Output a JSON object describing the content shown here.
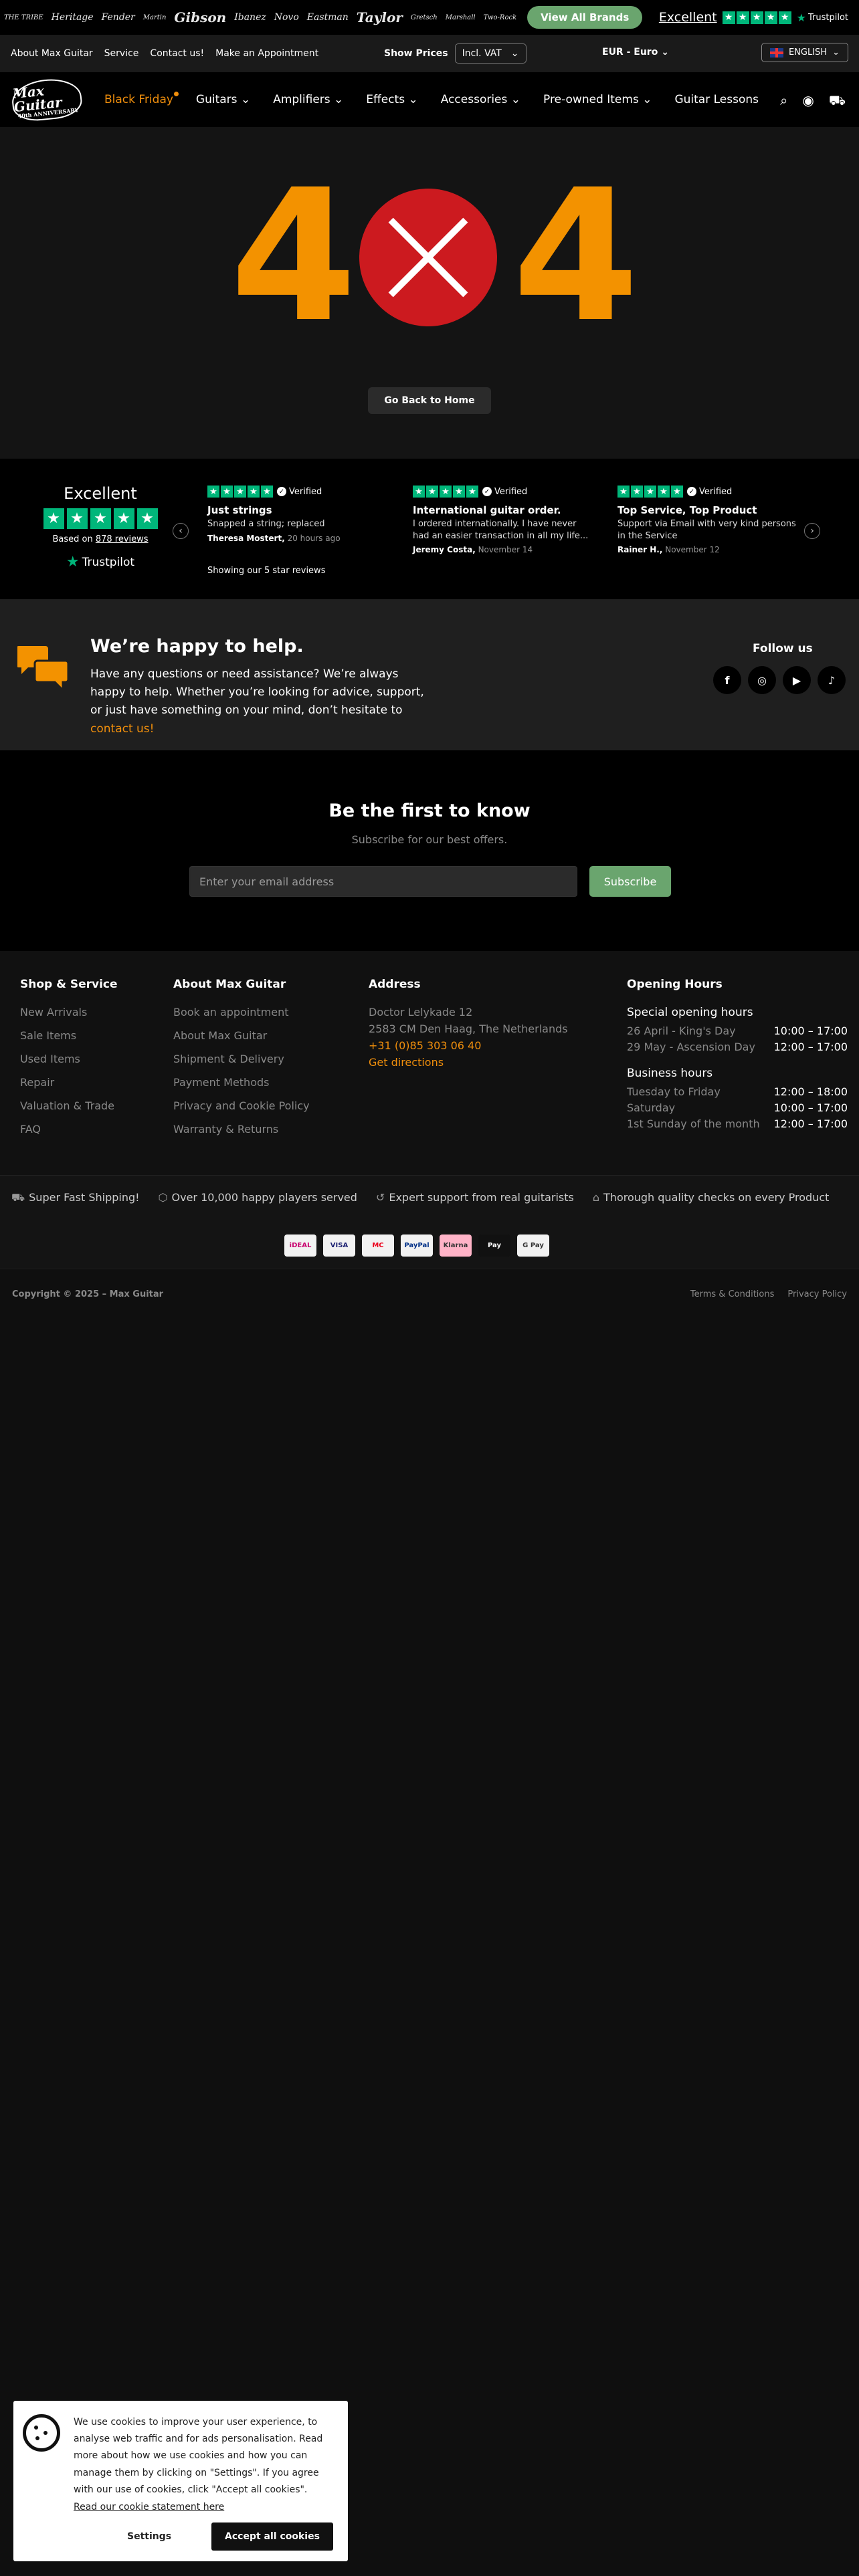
{
  "brands": [
    "THE TRIBE",
    "Heritage",
    "Fender",
    "Martin",
    "Gibson",
    "Ibanez",
    "Novo",
    "Eastman",
    "Taylor",
    "Gretsch",
    "Marshall",
    "Two-Rock"
  ],
  "view_all": "View All Brands",
  "tp_top": {
    "excellent": "Excellent",
    "logo": "Trustpilot"
  },
  "topbar": {
    "links": [
      "About Max Guitar",
      "Service",
      "Contact us!",
      "Make an Appointment"
    ],
    "show_prices": "Show Prices",
    "vat": "Incl. VAT",
    "currency": "EUR - Euro",
    "language": "ENGLISH"
  },
  "logo": {
    "line1": "Max Guitar",
    "line2": "40th ANNIVERSARY"
  },
  "nav": {
    "items": [
      "Black Friday",
      "Guitars",
      "Amplifiers",
      "Effects",
      "Accessories",
      "Pre-owned Items",
      "Guitar Lessons"
    ]
  },
  "error": {
    "digit_left": "4",
    "digit_right": "4",
    "back": "Go Back to Home"
  },
  "trustpilot": {
    "title": "Excellent",
    "based": "Based on",
    "count": "878 reviews",
    "logo": "Trustpilot",
    "showing": "Showing our 5 star reviews",
    "verified": "Verified"
  },
  "reviews": [
    {
      "title": "Just strings",
      "text": "Snapped a string; replaced",
      "author": "Theresa Mostert,",
      "time": "20 hours ago"
    },
    {
      "title": "International guitar order.",
      "text": "I ordered internationally. I have never had an easier transaction in all my life...",
      "author": "Jeremy Costa,",
      "time": "November 14"
    },
    {
      "title": "Top Service, Top Product",
      "text": "Support via Email with very kind persons in the Service",
      "author": "Rainer H.,",
      "time": "November 12"
    }
  ],
  "help": {
    "title": "We’re happy to help.",
    "text": "Have any questions or need assistance? We’re always happy to help. Whether you’re looking for advice, support, or just have something on your mind, don’t hesitate to ",
    "link": "contact us!",
    "follow": "Follow us"
  },
  "newsletter": {
    "title": "Be the first to know",
    "subtitle": "Subscribe for our best offers.",
    "placeholder": "Enter your email address",
    "button": "Subscribe"
  },
  "footer": {
    "shop": {
      "title": "Shop & Service",
      "items": [
        "New Arrivals",
        "Sale Items",
        "Used Items",
        "Repair",
        "Valuation & Trade",
        "FAQ"
      ]
    },
    "about": {
      "title": "About Max Guitar",
      "items": [
        "Book an appointment",
        "About Max Guitar",
        "Shipment & Delivery",
        "Payment Methods",
        "Privacy and Cookie Policy",
        "Warranty & Returns"
      ]
    },
    "address": {
      "title": "Address",
      "line1": "Doctor Lelykade 12",
      "line2": "2583 CM Den Haag, The Netherlands",
      "phone": "+31 (0)85 303 06 40",
      "directions": "Get directions"
    },
    "hours": {
      "title": "Opening Hours",
      "special_title": "Special opening hours",
      "special": [
        [
          "26 April - King's Day",
          "10:00 – 17:00"
        ],
        [
          "29 May - Ascension Day",
          "12:00 – 17:00"
        ]
      ],
      "business_title": "Business hours",
      "business": [
        [
          "Tuesday to Friday",
          "12:00 – 18:00"
        ],
        [
          "Saturday",
          "10:00 – 17:00"
        ],
        [
          "1st Sunday of the month",
          "12:00 – 17:00"
        ]
      ]
    }
  },
  "usps": [
    "Super Fast Shipping!",
    "Over 10,000 happy players served",
    "Expert support from real guitarists",
    "Thorough quality checks on every Product"
  ],
  "payments": [
    "iDEAL",
    "VISA",
    "MC",
    "PayPal",
    "Klarna",
    "Pay",
    "G Pay"
  ],
  "bottom": {
    "copyright": "Copyright © 2025 – Max Guitar",
    "terms": "Terms & Conditions",
    "privacy": "Privacy Policy"
  },
  "cookie": {
    "text": "We use cookies to improve your user experience, to analyse web traffic and for ads personalisation. Read more about how we use cookies and how you can manage them by clicking on \"Settings\". If you agree with our use of cookies, click \"Accept all cookies\".",
    "statement": "Read our cookie statement here",
    "settings": "Settings",
    "accept": "Accept all cookies"
  },
  "colors": {
    "accent": "#f39200",
    "green": "#6aa56e",
    "trustpilot": "#00b67a",
    "error_red": "#cc1a1f"
  }
}
